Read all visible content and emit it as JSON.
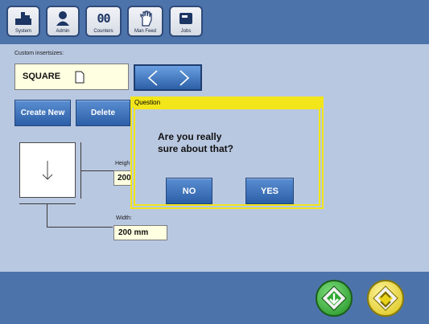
{
  "toolbar": {
    "items": [
      {
        "label": "System",
        "icon": "system-icon"
      },
      {
        "label": "Admin",
        "icon": "admin-icon"
      },
      {
        "label": "Counters",
        "icon": "counters-icon"
      },
      {
        "label": "Man Feed",
        "icon": "hand-icon"
      },
      {
        "label": "Jobs",
        "icon": "jobs-icon"
      }
    ],
    "counters_glyph": "00"
  },
  "insert": {
    "section_label": "Custom insertsizes:",
    "selected_value": "SQUARE"
  },
  "actions": {
    "create_new": "Create New",
    "delete": "Delete"
  },
  "dimensions": {
    "height_label": "Heigh",
    "height_value": "200",
    "width_label": "Width:",
    "width_value": "200 mm"
  },
  "dialog": {
    "title": "Question",
    "message_line1": "Are you really",
    "message_line2": "sure about that?",
    "no_label": "NO",
    "yes_label": "YES"
  },
  "footer": {
    "start_icon": "start-icon",
    "reset_icon": "reset-icon"
  },
  "colors": {
    "background": "#b9c8e1",
    "bar": "#4d73ab",
    "button_blue": "#2c5fa6",
    "field_yellow": "#ffffe1",
    "dialog_border": "#f2e51a",
    "start_green": "#2ea82e",
    "reset_yellow": "#e8d21a"
  }
}
